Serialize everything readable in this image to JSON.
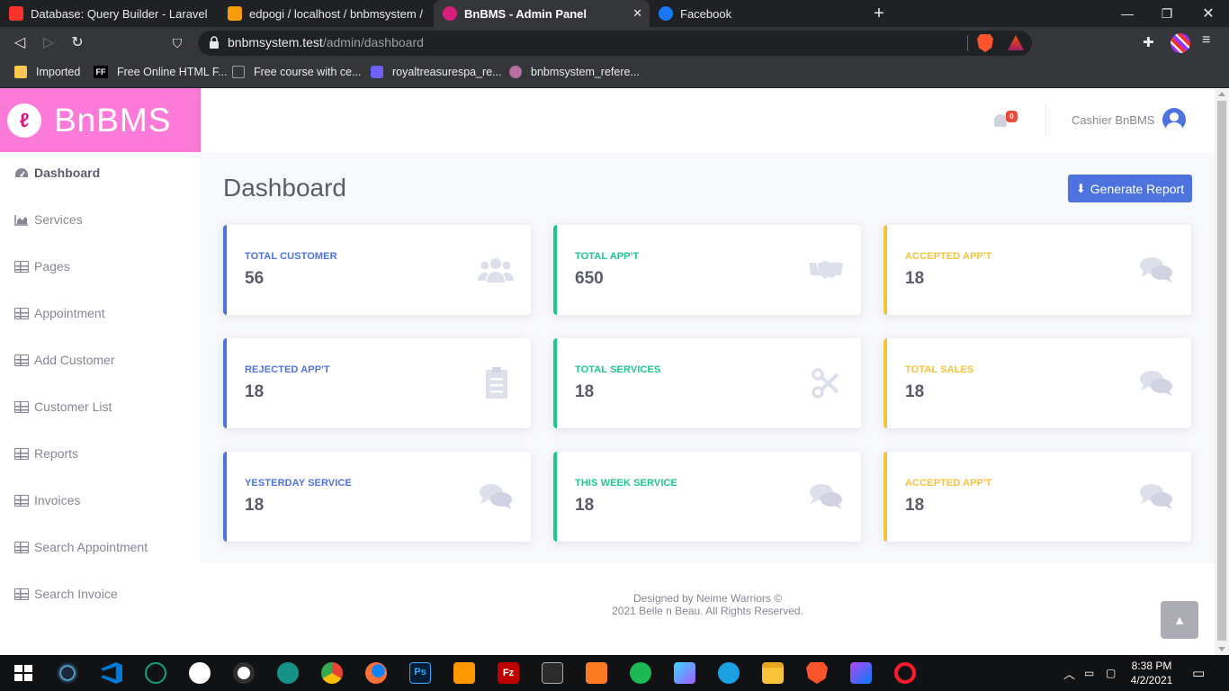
{
  "browser": {
    "tabs": [
      {
        "label": "Database: Query Builder - Laravel - Th",
        "color": "#f9322c"
      },
      {
        "label": "edpogi / localhost / bnbmsystem / us",
        "color": "#f89c0e"
      },
      {
        "label": "BnBMS - Admin Panel",
        "color": "#d91d7d"
      },
      {
        "label": "Facebook",
        "color": "#1877f2"
      }
    ],
    "url_host": "bnbmsystem.test",
    "url_path": "/admin/dashboard",
    "bookmarks": [
      {
        "label": "Imported",
        "icon": "folder-icon"
      },
      {
        "label": "Free Online HTML F...",
        "icon": "ff-icon"
      },
      {
        "label": "Free course with ce...",
        "icon": "rd-icon"
      },
      {
        "label": "royaltreasurespa_re...",
        "icon": "db-icon"
      },
      {
        "label": "bnbmsystem_refere...",
        "icon": "profile-icon"
      }
    ]
  },
  "brand": {
    "name": "BnBMS",
    "color": "#fc7ad8"
  },
  "sidebar": {
    "items": [
      {
        "label": "Dashboard",
        "icon": "tachometer-icon",
        "active": true
      },
      {
        "label": "Services",
        "icon": "chart-area-icon"
      },
      {
        "label": "Pages",
        "icon": "table-icon"
      },
      {
        "label": "Appointment",
        "icon": "table-icon"
      },
      {
        "label": "Add Customer",
        "icon": "table-icon"
      },
      {
        "label": "Customer List",
        "icon": "table-icon"
      },
      {
        "label": "Reports",
        "icon": "table-icon"
      },
      {
        "label": "Invoices",
        "icon": "table-icon"
      },
      {
        "label": "Search Appointment",
        "icon": "table-icon"
      },
      {
        "label": "Search Invoice",
        "icon": "table-icon"
      }
    ]
  },
  "topbar": {
    "notification_count": "0",
    "user_name": "Cashier BnBMS"
  },
  "page": {
    "title": "Dashboard",
    "generate_report_label": "Generate Report"
  },
  "cards": [
    {
      "label": "TOTAL CUSTOMER",
      "value": "56",
      "variant": "primary",
      "icon": "users-icon"
    },
    {
      "label": "TOTAL APP'T",
      "value": "650",
      "variant": "success",
      "icon": "handshake-icon"
    },
    {
      "label": "ACCEPTED APP'T",
      "value": "18",
      "variant": "warning",
      "icon": "comments-icon"
    },
    {
      "label": "REJECTED APP'T",
      "value": "18",
      "variant": "primary",
      "icon": "clipboard-list-icon"
    },
    {
      "label": "TOTAL SERVICES",
      "value": "18",
      "variant": "success",
      "icon": "scissors-icon"
    },
    {
      "label": "TOTAL SALES",
      "value": "18",
      "variant": "warning",
      "icon": "comments-icon"
    },
    {
      "label": "YESTERDAY SERVICE",
      "value": "18",
      "variant": "primary",
      "icon": "comments-icon"
    },
    {
      "label": "THIS WEEK SERVICE",
      "value": "18",
      "variant": "success",
      "icon": "comments-icon"
    },
    {
      "label": "ACCEPTED APP'T",
      "value": "18",
      "variant": "warning",
      "icon": "comments-icon"
    }
  ],
  "footer": {
    "line1": "Designed by Neime Warriors ©",
    "line2": "2021 Belle n Beau. All Rights Reserved."
  },
  "colors": {
    "primary": "#4e73df",
    "success": "#1cc88a",
    "warning": "#f6c23e",
    "text": "#5a5c69"
  },
  "taskbar": {
    "time": "8:38 PM",
    "date": "4/2/2021"
  }
}
